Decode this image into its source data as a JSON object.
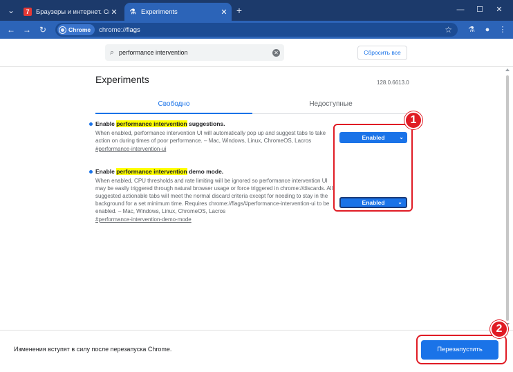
{
  "browser": {
    "tabs": [
      {
        "title": "Браузеры и интернет. Скача",
        "favicon": "site-favicon",
        "active": false
      },
      {
        "title": "Experiments",
        "favicon": "flask-icon",
        "active": true
      }
    ],
    "newtab_icon": "plus-icon",
    "window_controls": {
      "tab_search": "chevron-down-icon",
      "minimize": "minimize-icon",
      "maximize": "maximize-icon",
      "close": "close-icon"
    },
    "toolbar": {
      "back": "back-arrow-icon",
      "forward": "forward-arrow-icon",
      "reload": "reload-icon",
      "chip_label": "Chrome",
      "url_scheme": "chrome://",
      "url_path": "flags",
      "bookmark": "star-icon",
      "labs": "flask-icon",
      "profile": "person-icon",
      "menu": "more-vert-icon"
    }
  },
  "search": {
    "value": "performance intervention",
    "reset_label": "Сбросить все"
  },
  "header": {
    "title": "Experiments",
    "version": "128.0.6613.0"
  },
  "tabs": {
    "available": "Свободно",
    "unavailable": "Недоступные"
  },
  "experiments": [
    {
      "name_prefix": "Enable ",
      "name_highlight": "performance intervention",
      "name_suffix": " suggestions.",
      "description": "When enabled, performance intervention UI will automatically pop up and suggest tabs to take action on during times of poor performance. – Mac, Windows, Linux, ChromeOS, Lacros",
      "anchor": "#performance-intervention-ui",
      "select_value": "Enabled"
    },
    {
      "name_prefix": "Enable ",
      "name_highlight": "performance intervention",
      "name_suffix": " demo mode.",
      "description": "When enabled, CPU thresholds and rate limiting will be ignored so performance intervention UI may be easily triggered through natural browser usage or force triggered in chrome://discards. All suggested actionable tabs will meet the normal discard criteria except for needing to stay in the background for a set minimum time. Requires chrome://flags/#performance-intervention-ui to be enabled. – Mac, Windows, Linux, ChromeOS, Lacros",
      "anchor": "#performance-intervention-demo-mode",
      "select_value": "Enabled"
    }
  ],
  "annotations": {
    "badge1": "1",
    "badge2": "2",
    "color": "#e01b24"
  },
  "footer": {
    "message": "Изменения вступят в силу после перезапуска Chrome.",
    "restart_label": "Перезапустить"
  },
  "colors": {
    "accent": "#1a73e8",
    "frame": "#1c3a6b",
    "toolbar": "#2c64b8"
  }
}
